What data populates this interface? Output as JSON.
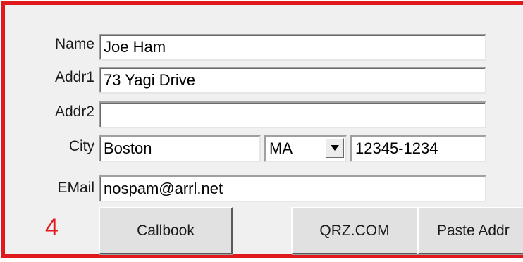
{
  "form": {
    "name_label": "Name",
    "name_value": "Joe Ham",
    "addr1_label": "Addr1",
    "addr1_value": "73 Yagi Drive",
    "addr2_label": "Addr2",
    "addr2_value": "",
    "city_label": "City",
    "city_value": "Boston",
    "state_value": "MA",
    "zip_value": "12345-1234",
    "email_label": "EMail",
    "email_value": "nospam@arrl.net"
  },
  "callout_number": "4",
  "buttons": {
    "callbook": "Callbook",
    "qrz": "QRZ.COM",
    "paste_addr": "Paste Addr"
  },
  "colors": {
    "highlight_border": "#e0191c",
    "panel_background": "#f0f0f0"
  },
  "icons": {
    "state_dropdown": "chevron-down-icon"
  }
}
